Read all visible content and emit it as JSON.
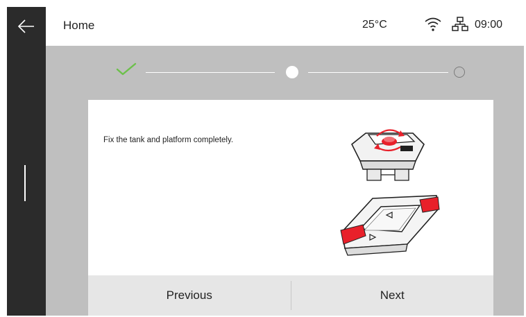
{
  "header": {
    "title": "Home",
    "temperature": "25°C",
    "time": "09:00"
  },
  "icons": {
    "back": "arrow-left-icon",
    "wifi": "wifi-icon",
    "network": "network-icon",
    "step_done": "check-icon"
  },
  "stepper": {
    "total_steps": 3,
    "current_step": 2
  },
  "card": {
    "instruction": "Fix the tank and platform completely.",
    "illustrations": [
      "platform-illustration",
      "tank-illustration"
    ]
  },
  "footer": {
    "previous_label": "Previous",
    "next_label": "Next"
  },
  "colors": {
    "sidebar": "#2b2b2b",
    "background": "#bfbfbf",
    "check": "#6cc04a",
    "highlight": "#e8202a"
  }
}
